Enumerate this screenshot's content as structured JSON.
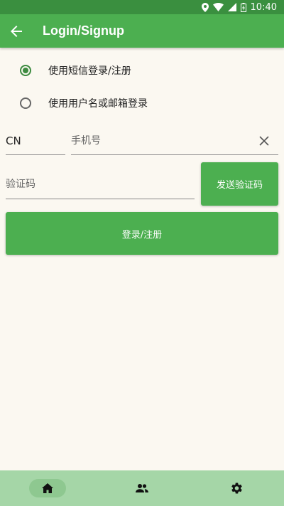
{
  "status_bar": {
    "time": "10:40"
  },
  "app_bar": {
    "title": "Login/Signup"
  },
  "login_mode": {
    "options": [
      {
        "label": "使用短信登录/注册",
        "selected": true
      },
      {
        "label": "使用用户名或邮箱登录",
        "selected": false
      }
    ]
  },
  "form": {
    "country_code": "CN",
    "phone_placeholder": "手机号",
    "code_placeholder": "验证码",
    "send_code_label": "发送验证码",
    "submit_label": "登录/注册"
  },
  "bottom_nav": {
    "items": [
      {
        "icon": "home-icon",
        "active": true
      },
      {
        "icon": "people-icon",
        "active": false
      },
      {
        "icon": "settings-icon",
        "active": false
      }
    ]
  },
  "colors": {
    "status_bar": "#3a8f3f",
    "primary": "#4caf50",
    "background": "#fbf8f1",
    "nav_background": "#a5d6a7",
    "radio_active": "#3d8b40"
  }
}
